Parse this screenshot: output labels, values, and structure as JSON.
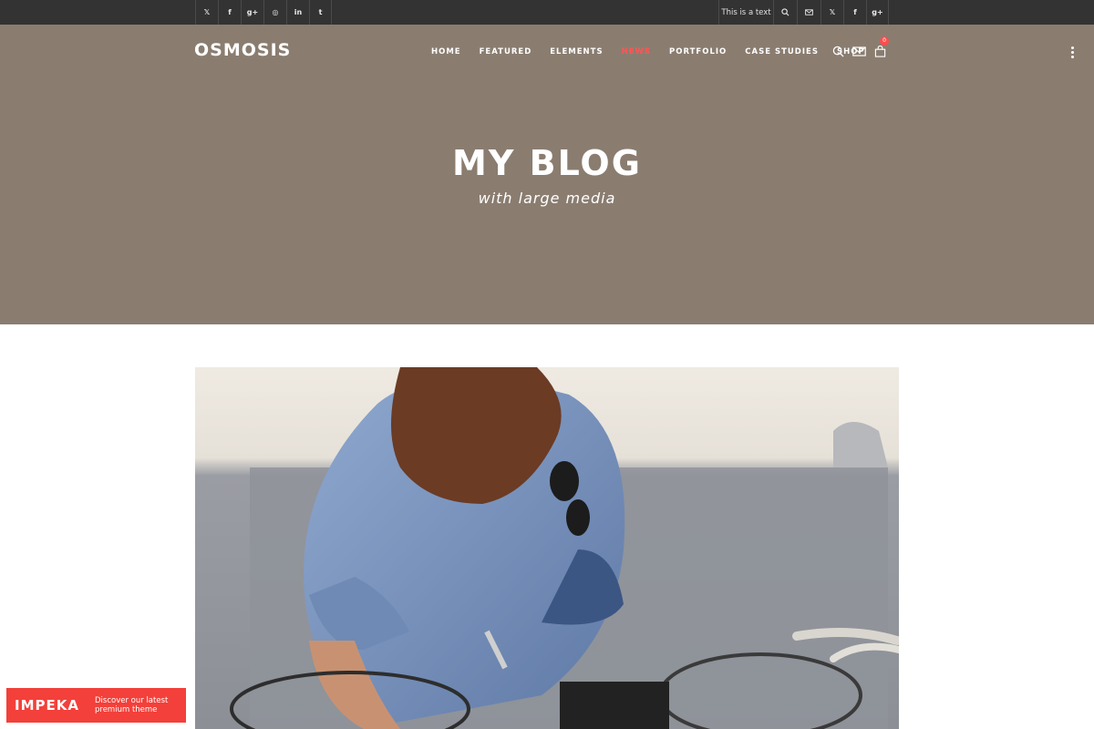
{
  "topbar": {
    "social_left": [
      "𝕏",
      "f",
      "g+",
      "◎",
      "in",
      "t"
    ],
    "text": "This is a text",
    "social_right": [
      "𝕏",
      "f",
      "g+"
    ]
  },
  "header": {
    "logo": "OSMOSIS",
    "nav": [
      {
        "label": "HOME",
        "active": false
      },
      {
        "label": "FEATURED",
        "active": false
      },
      {
        "label": "ELEMENTS",
        "active": false
      },
      {
        "label": "NEWS",
        "active": true
      },
      {
        "label": "PORTFOLIO",
        "active": false
      },
      {
        "label": "CASE STUDIES",
        "active": false
      },
      {
        "label": "SHOP",
        "active": false
      }
    ],
    "cart_count": "0",
    "accent_color": "#ff5555",
    "background_color": "#8a7d70"
  },
  "hero": {
    "title": "MY BLOG",
    "subtitle": "with large media"
  },
  "promo": {
    "logo": "IMPEKA",
    "line1": "Discover our latest",
    "line2": "premium theme",
    "color": "#f3403a"
  }
}
